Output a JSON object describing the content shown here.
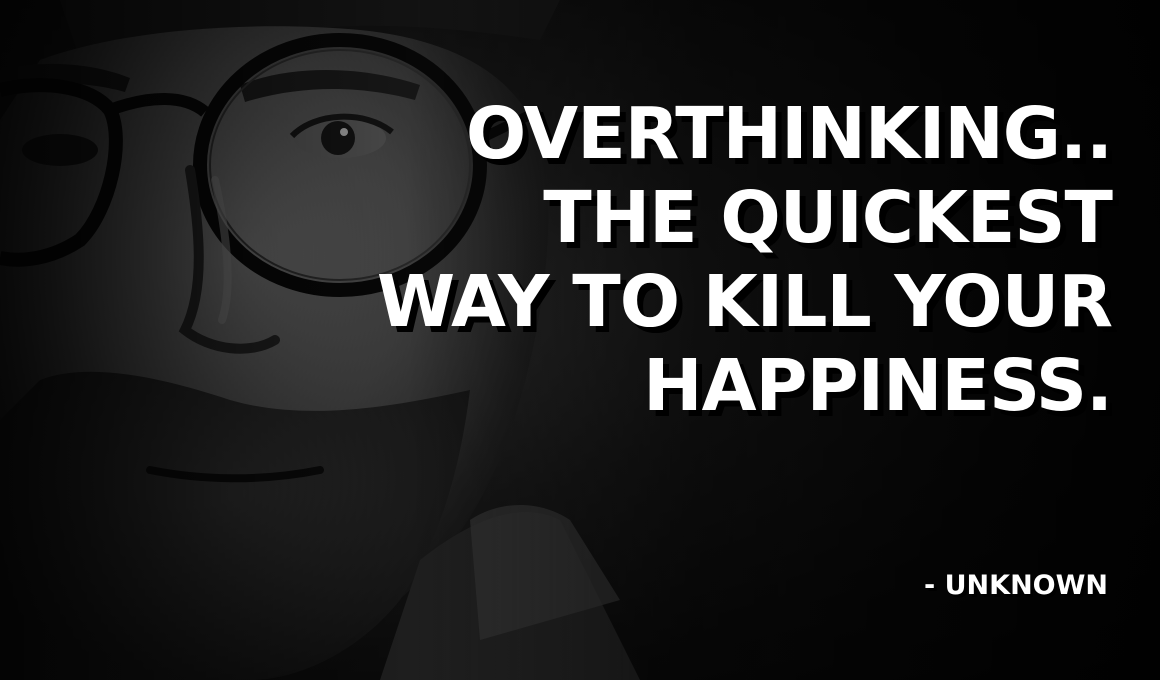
{
  "quote": {
    "lines": [
      "OVERTHINKING..",
      "THE QUICKEST",
      "WAY TO KILL YOUR",
      "HAPPINESS."
    ],
    "author": "- UNKNOWN"
  },
  "photo": {
    "subject": "man-with-glasses-portrait",
    "tone": "black-and-white"
  }
}
